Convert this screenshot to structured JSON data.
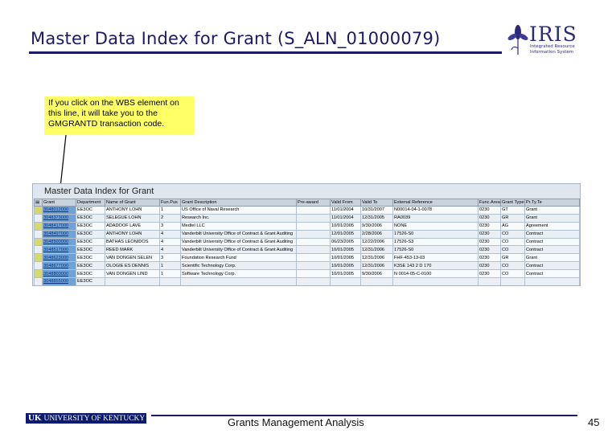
{
  "slide": {
    "title": "Master Data Index for Grant (S_ALN_01000079)",
    "page_number": "45",
    "footer_text": "Grants Management Analysis"
  },
  "logo": {
    "word": "IRIS",
    "subtitle": "Integrated Resource Information System"
  },
  "uk_logo": {
    "initials": "UK",
    "name": "UNIVERSITY OF KENTUCKY"
  },
  "callout": {
    "text": "If you click on the WBS element on this line, it will take you to the GMGRANTD transaction code."
  },
  "sap_report": {
    "title": "Master Data Index for Grant",
    "columns": [
      "Grant",
      "Department",
      "Name of Grant",
      "Fun.Pus",
      "Grant Description",
      "Pre-award",
      "Valid From",
      "Valid To",
      "External Reference",
      "Func.Area",
      "Grant Type",
      "Pr.Ty.Te"
    ],
    "rows": [
      {
        "grant": "3048012000",
        "dept": "EE3OC",
        "name": "ANTHONY LOHN",
        "fun": "1",
        "desc": "US Office of Naval Research",
        "pre": "",
        "from": "11/01/2004",
        "to": "10/31/2007",
        "ext": "N00014-04-1-0078",
        "func": "0230",
        "type": "GT",
        "prty": "Grant"
      },
      {
        "grant": "3048373000",
        "dept": "EE3OC",
        "name": "SELEGUE LOHN",
        "fun": "2",
        "desc": "Research Inc.",
        "pre": "",
        "from": "11/01/2004",
        "to": "12/31/2005",
        "ext": "RA0039",
        "func": "0230",
        "type": "GR",
        "prty": "Grant"
      },
      {
        "grant": "3048417000",
        "dept": "EE3OC",
        "name": "ADADOOF LAVE",
        "fun": "3",
        "desc": "Medtel LLC",
        "pre": "",
        "from": "10/01/2005",
        "to": "9/30/2006",
        "ext": "NONE",
        "func": "0230",
        "type": "AG",
        "prty": "Agreement"
      },
      {
        "grant": "3048497000",
        "dept": "EE3OC",
        "name": "ANTHONY LOHN",
        "fun": "4",
        "desc": "Vanderbilt University Office of Contract & Grant Auditing",
        "pre": "",
        "from": "12/01/2005",
        "to": "2/28/2006",
        "ext": "17526-S0",
        "func": "0230",
        "type": "CO",
        "prty": "Contract"
      },
      {
        "grant": "3048500000",
        "dept": "EE3OC",
        "name": "BATHAS LEONIDOS",
        "fun": "4",
        "desc": "Vanderbilt University Office of Contract & Grant Auditing",
        "pre": "",
        "from": "06/23/2005",
        "to": "12/22/2006",
        "ext": "17526-S3",
        "func": "0230",
        "type": "CO",
        "prty": "Contract"
      },
      {
        "grant": "3048517000",
        "dept": "EE3OC",
        "name": "REED MARK",
        "fun": "4",
        "desc": "Vanderbilt University Office of Contract & Grant Auditing",
        "pre": "",
        "from": "10/01/2005",
        "to": "12/31/2006",
        "ext": "17526-S0",
        "func": "0230",
        "type": "CO",
        "prty": "Contract"
      },
      {
        "grant": "3048623000",
        "dept": "EE3OC",
        "name": "VAN DONGEN SELEN",
        "fun": "3",
        "desc": "Foundation Research Fund",
        "pre": "",
        "from": "10/01/2005",
        "to": "12/31/2006",
        "ext": "FHF-453-13-03",
        "func": "0230",
        "type": "GR",
        "prty": "Grant"
      },
      {
        "grant": "3048677000",
        "dept": "EE3OC",
        "name": "OLOGIE ES DENNIS",
        "fun": "1",
        "desc": "Scientific Technology Corp.",
        "pre": "",
        "from": "10/01/2005",
        "to": "12/31/2006",
        "ext": "K3SE 143 2 D 170",
        "func": "0230",
        "type": "CO",
        "prty": "Contract"
      },
      {
        "grant": "3048800000",
        "dept": "EE3OC",
        "name": "VAN DONGEN LIND",
        "fun": "1",
        "desc": "Software Technology Corp.",
        "pre": "",
        "from": "10/01/2005",
        "to": "9/30/2006",
        "ext": "N 0014-05-C-0100",
        "func": "0230",
        "type": "CO",
        "prty": "Contract"
      },
      {
        "grant": "3048855000",
        "dept": "EE3OC",
        "name": "",
        "fun": "",
        "desc": "",
        "pre": "",
        "from": "",
        "to": "",
        "ext": "",
        "func": "",
        "type": "",
        "prty": ""
      }
    ]
  },
  "colors": {
    "title": "#1a1a66",
    "callout_bg": "#ffff66",
    "wbs_highlight": "#6fa3d8",
    "uk_blue": "#0d1b6e"
  },
  "icons": {
    "logo_flower": "iris-flower-icon",
    "arrow": "callout-arrow"
  }
}
